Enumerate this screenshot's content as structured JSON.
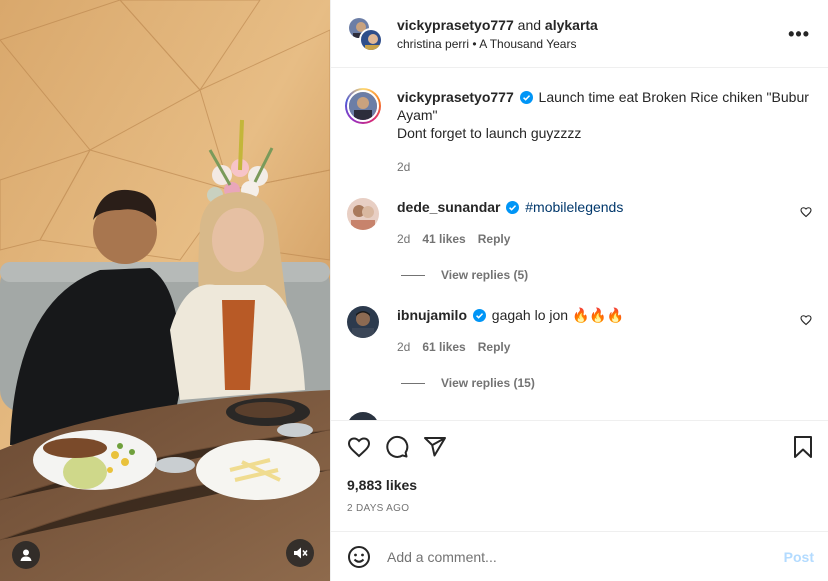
{
  "header": {
    "user1": "vickyprasetyo777",
    "joiner": " and ",
    "user2": "alykarta",
    "music_artist": "christina perri",
    "music_sep": " • ",
    "music_title": "A Thousand Years",
    "more_label": "•••"
  },
  "caption": {
    "username": "vickyprasetyo777",
    "text": " Launch time eat Broken Rice chiken \"Bubur Ayam\"",
    "text2": "Dont forget to launch guyzzzz",
    "time": "2d"
  },
  "comments": [
    {
      "username": "dede_sunandar",
      "hashtag": "#mobilelegends",
      "time": "2d",
      "likes": "41 likes",
      "reply": "Reply",
      "view_replies": "View replies (5)"
    },
    {
      "username": "ibnujamilo",
      "text": " gagah lo jon 🔥🔥🔥",
      "time": "2d",
      "likes": "61 likes",
      "reply": "Reply",
      "view_replies": "View replies (15)"
    }
  ],
  "post": {
    "likes": "9,883 likes",
    "date": "2 DAYS AGO"
  },
  "add_comment": {
    "placeholder": "Add a comment...",
    "post_label": "Post"
  },
  "icons": {
    "heart": "heart-icon",
    "comment": "comment-icon",
    "share": "share-icon",
    "save": "bookmark-icon",
    "emoji": "emoji-icon",
    "tag": "user-tag-icon",
    "mute": "muted-speaker-icon",
    "verified": "verified-badge-icon"
  },
  "colors": {
    "verified": "#0095f6",
    "post_disabled": "#b3dbff",
    "hashtag": "#00376b",
    "muted_text": "#737373"
  }
}
